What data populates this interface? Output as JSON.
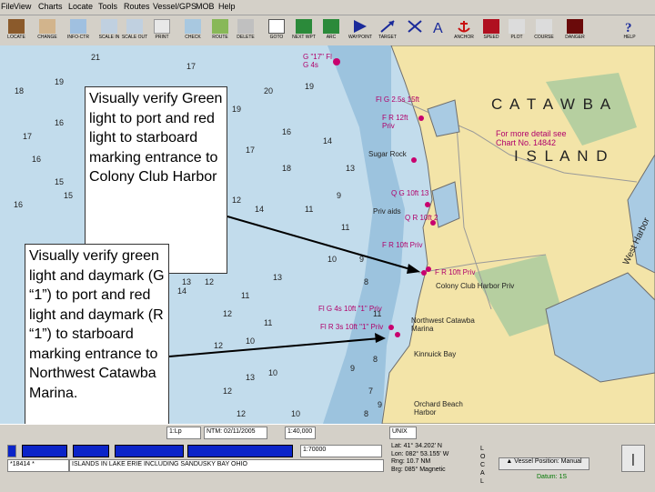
{
  "menu": [
    "File",
    "View",
    "Charts",
    "Locate",
    "Tools",
    "Routes",
    "Vessel/GPS",
    "MOB",
    "Help"
  ],
  "toolbar": [
    "LOCATE",
    "CHANGE",
    "INFO-CTR",
    "SCALE IN",
    "SCALE OUT",
    "PRINT",
    "CHECK",
    "ROUTE",
    "DELETE",
    "GOTO",
    "NEXT WPT",
    "ARC",
    "WAYPOINT",
    "TARGET",
    "ANCHOR",
    "SPEED",
    "PLOT",
    "COURSE",
    "DANGER",
    "HELP"
  ],
  "callouts": {
    "top": "Visually verify Green light to port and red light to starboard marking entrance to Colony Club Harbor",
    "bottom": "Visually verify green light and daymark (G “1”) to port and red light and daymark (R “1”) to starboard marking entrance to Northwest Catawba Marina."
  },
  "chart_labels": {
    "catawba_top": "C A T A W B A",
    "catawba_island": "I S L A N D",
    "detail_note": "For more detail see Chart No. 14842",
    "colony_harbor": "Colony Club Harbor Priv",
    "nw_marina": "Northwest Catawba Marina",
    "sugar_rock": "Sugar Rock",
    "orchard": "Orchard Beach Harbor",
    "g17": "G \"17\" Fl G 4s",
    "fl_g_2_5s": "Fl G 2.5s 15ft",
    "fr12": "F R 12ft Priv",
    "fr10": "F R 10ft Priv",
    "og": "Q G 10ft 13",
    "qr": "Q R 10ft 2",
    "fr_dot": "F R 10ft Priv",
    "g1": "Fl G 4s 10ft \"1\" Priv",
    "r1": "Fl R 3s 10ft \"1\" Priv",
    "kinnuick": "Kinnuick Bay",
    "harbor_right": "West Harbor",
    "priv_aids": "Priv aids"
  },
  "soundings": [
    "21",
    "19",
    "20",
    "18",
    "19",
    "17",
    "18",
    "19",
    "17",
    "16",
    "18",
    "16",
    "15",
    "16",
    "17",
    "15",
    "14",
    "16",
    "15",
    "14",
    "12",
    "15",
    "14",
    "13",
    "11",
    "13",
    "12",
    "14",
    "11",
    "13",
    "12",
    "10",
    "11",
    "12",
    "9",
    "11",
    "10",
    "13",
    "12",
    "10",
    "12",
    "9",
    "8",
    "11",
    "10",
    "9",
    "8",
    "7",
    "9",
    "8"
  ],
  "status": {
    "scale_prefix": "1:",
    "scale_value": "Lp",
    "ntm": "NTM: 02/11/2005",
    "chart_info": "1:40,000",
    "scale_right": "1:70000",
    "lat_label": "Lat:",
    "lat": "41° 34.202' N",
    "lon_label": "Lon:",
    "lon": "082° 53.155' W",
    "rng_label": "Rng:",
    "rng": "10.7 NM",
    "brg_label": "Brg:",
    "brg": "085° Magnetic",
    "chart_no_prefix": "*18414 *",
    "chart_title": "ISLANDS IN LAKE ERIE INCLUDING SANDUSKY BAY OHIO",
    "local": "L O C A L",
    "vessel_btn": "Vessel Position: Manual",
    "datum": "Datum: 1S",
    "unix": "UNIX"
  },
  "colors": {
    "water_deep": "#c2dcec",
    "water_shallow": "#8fb8d6",
    "land": "#f3e4a8",
    "marsh": "#b6cfa0",
    "magenta": "#c8006e",
    "status_blue": "#0b24c8"
  }
}
